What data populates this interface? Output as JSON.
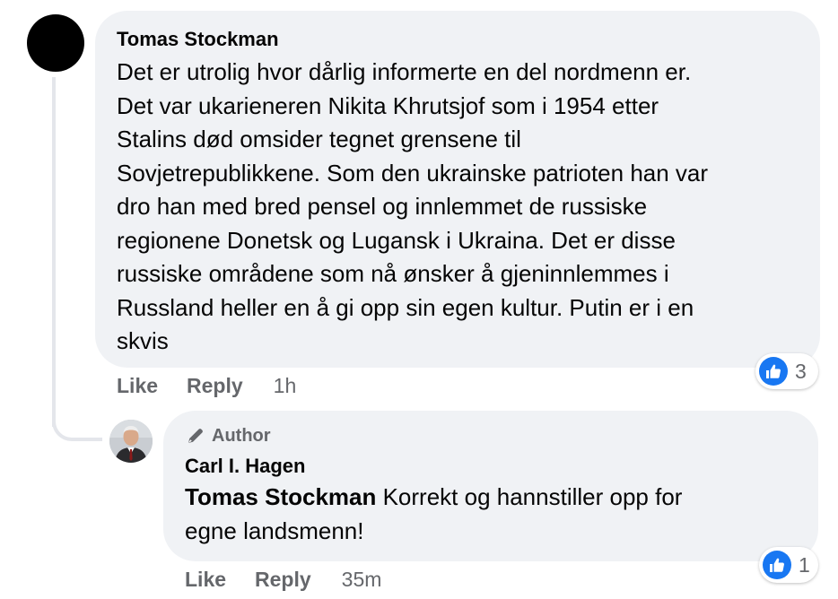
{
  "colors": {
    "bubble_background": "#f0f2f5",
    "secondary_text": "#65676b",
    "primary_text": "#050505",
    "like_blue": "#1877f2",
    "thread_line": "#e4e6eb"
  },
  "comment": {
    "author": "Tomas Stockman",
    "avatar_icon": "profile-avatar",
    "text_lines": [
      "Det er utrolig hvor dårlig informerte en del nordmenn er.",
      "Det var ukarieneren Nikita Khrutsjof som i 1954 etter",
      "Stalins død omsider tegnet grensene til",
      "Sovjetrepublikkene. Som den ukrainske patrioten han var",
      "dro han med bred pensel og innlemmet de russiske",
      "regionene Donetsk og Lugansk i Ukraina. Det er disse",
      "russiske områdene som nå ønsker å gjeninnlemmes i",
      "Russland heller en å gi opp sin egen kultur. Putin er i en",
      "skvis"
    ],
    "actions": {
      "like_label": "Like",
      "reply_label": "Reply",
      "timestamp": "1h"
    },
    "reaction": {
      "icon": "like-thumbs-up-icon",
      "count": "3"
    }
  },
  "reply": {
    "badge_icon": "pen-icon",
    "badge_label": "Author",
    "author": "Carl I. Hagen",
    "avatar_icon": "profile-avatar",
    "mention": "Tomas Stockman",
    "text_first": " Korrekt og hannstiller opp for",
    "text_second": "egne landsmenn!",
    "actions": {
      "like_label": "Like",
      "reply_label": "Reply",
      "timestamp": "35m"
    },
    "reaction": {
      "icon": "like-thumbs-up-icon",
      "count": "1"
    }
  }
}
